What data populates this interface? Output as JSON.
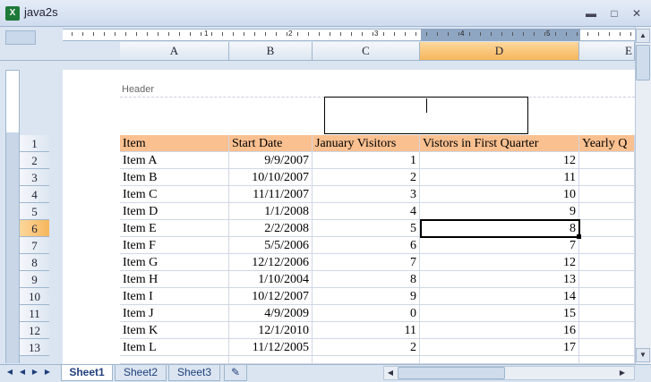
{
  "window": {
    "title": "java2s",
    "icon": "excel-icon"
  },
  "ruler": {
    "marks": [
      "1",
      "2",
      "3",
      "4",
      "5"
    ]
  },
  "columns": [
    "A",
    "B",
    "C",
    "D",
    "E"
  ],
  "rows": [
    "1",
    "2",
    "3",
    "4",
    "5",
    "6",
    "7",
    "8",
    "9",
    "10",
    "11",
    "12",
    "13"
  ],
  "page": {
    "header_label": "Header"
  },
  "table": {
    "headers": [
      "Item",
      "Start Date",
      "January Visitors",
      "Vistors in First Quarter",
      "Yearly Q"
    ],
    "data": [
      [
        "Item A",
        "9/9/2007",
        "1",
        "12"
      ],
      [
        "Item B",
        "10/10/2007",
        "2",
        "11"
      ],
      [
        "Item C",
        "11/11/2007",
        "3",
        "10"
      ],
      [
        "Item D",
        "1/1/2008",
        "4",
        "9"
      ],
      [
        "Item E",
        "2/2/2008",
        "5",
        "8"
      ],
      [
        "Item F",
        "5/5/2006",
        "6",
        "7"
      ],
      [
        "Item G",
        "12/12/2006",
        "7",
        "12"
      ],
      [
        "Item H",
        "1/10/2004",
        "8",
        "13"
      ],
      [
        "Item I",
        "10/12/2007",
        "9",
        "14"
      ],
      [
        "Item J",
        "4/9/2009",
        "0",
        "15"
      ],
      [
        "Item K",
        "12/1/2010",
        "11",
        "16"
      ],
      [
        "Item L",
        "11/12/2005",
        "2",
        "17"
      ]
    ]
  },
  "selection": {
    "column": "D",
    "row": "6"
  },
  "sheets": [
    "Sheet1",
    "Sheet2",
    "Sheet3"
  ],
  "active_sheet": "Sheet1",
  "colors": {
    "header_fill": "#fac090",
    "selected_header": "#f6b65c"
  }
}
